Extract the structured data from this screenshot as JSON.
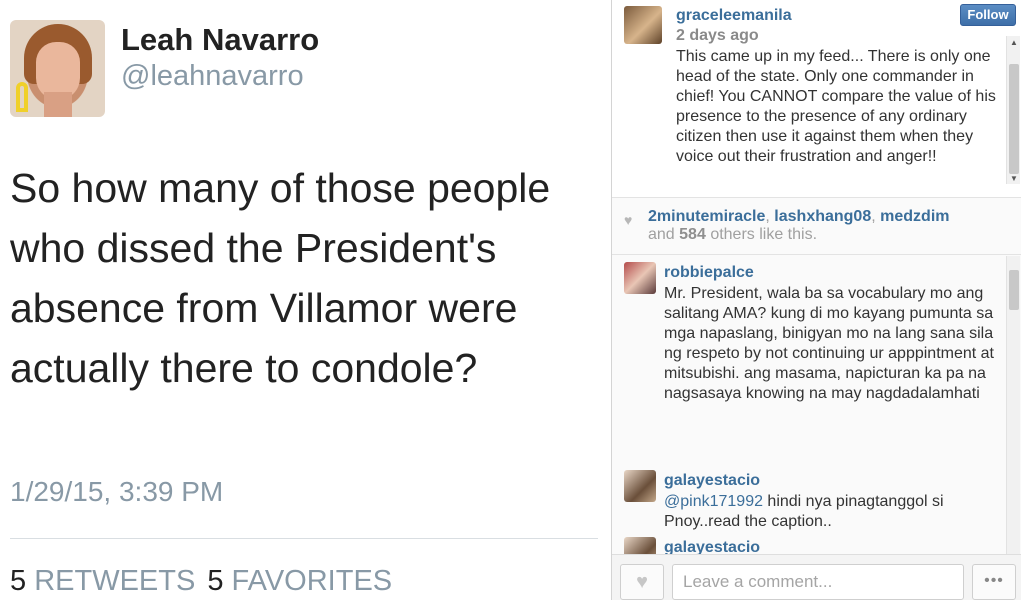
{
  "tweet": {
    "author_name": "Leah Navarro",
    "author_handle": "@leahnavarro",
    "text": "So how many of those people who dissed the President's absence from Villamor were actually there to condole?",
    "timestamp": "1/29/15, 3:39 PM",
    "retweets_count": "5",
    "retweets_label": "RETWEETS",
    "favorites_count": "5",
    "favorites_label": "FAVORITES"
  },
  "instagram": {
    "caption": {
      "username": "graceleemanila",
      "time_ago": "2 days ago",
      "text": "This came up in my feed... There is only one head of the state. Only one commander in chief! You CANNOT compare the value of his presence to the presence of any ordinary citizen then use it against them when they voice out their frustration and anger!!",
      "follow_label": "Follow"
    },
    "likes": {
      "users": [
        "2minutemiracle",
        "lashxhang08",
        "medzdim"
      ],
      "separator": ",",
      "and_label": "and",
      "others_count": "584",
      "others_suffix": "others like this."
    },
    "comments": [
      {
        "username": "robbiepalce",
        "text": "Mr. President, wala ba sa vocabulary mo ang salitang AMA? kung di mo kayang pumunta sa mga napaslang, binigyan mo na lang sana sila ng respeto by not continuing ur apppintment at mitsubishi. ang masama, napicturan ka pa na nagsasaya knowing na may nagdadalamhati"
      },
      {
        "username": "galayestacio",
        "mention": "@pink171992",
        "text": " hindi nya pinagtanggol si Pnoy..read the caption.."
      },
      {
        "username": "galayestacio",
        "text": ""
      }
    ],
    "comment_input": {
      "placeholder": "Leave a comment..."
    },
    "more_label": "•••",
    "icons": {
      "like": "heart-icon",
      "more": "ellipsis-icon"
    },
    "colors": {
      "link_blue": "#3b6e9a",
      "follow_button": "#4a7db8"
    }
  }
}
